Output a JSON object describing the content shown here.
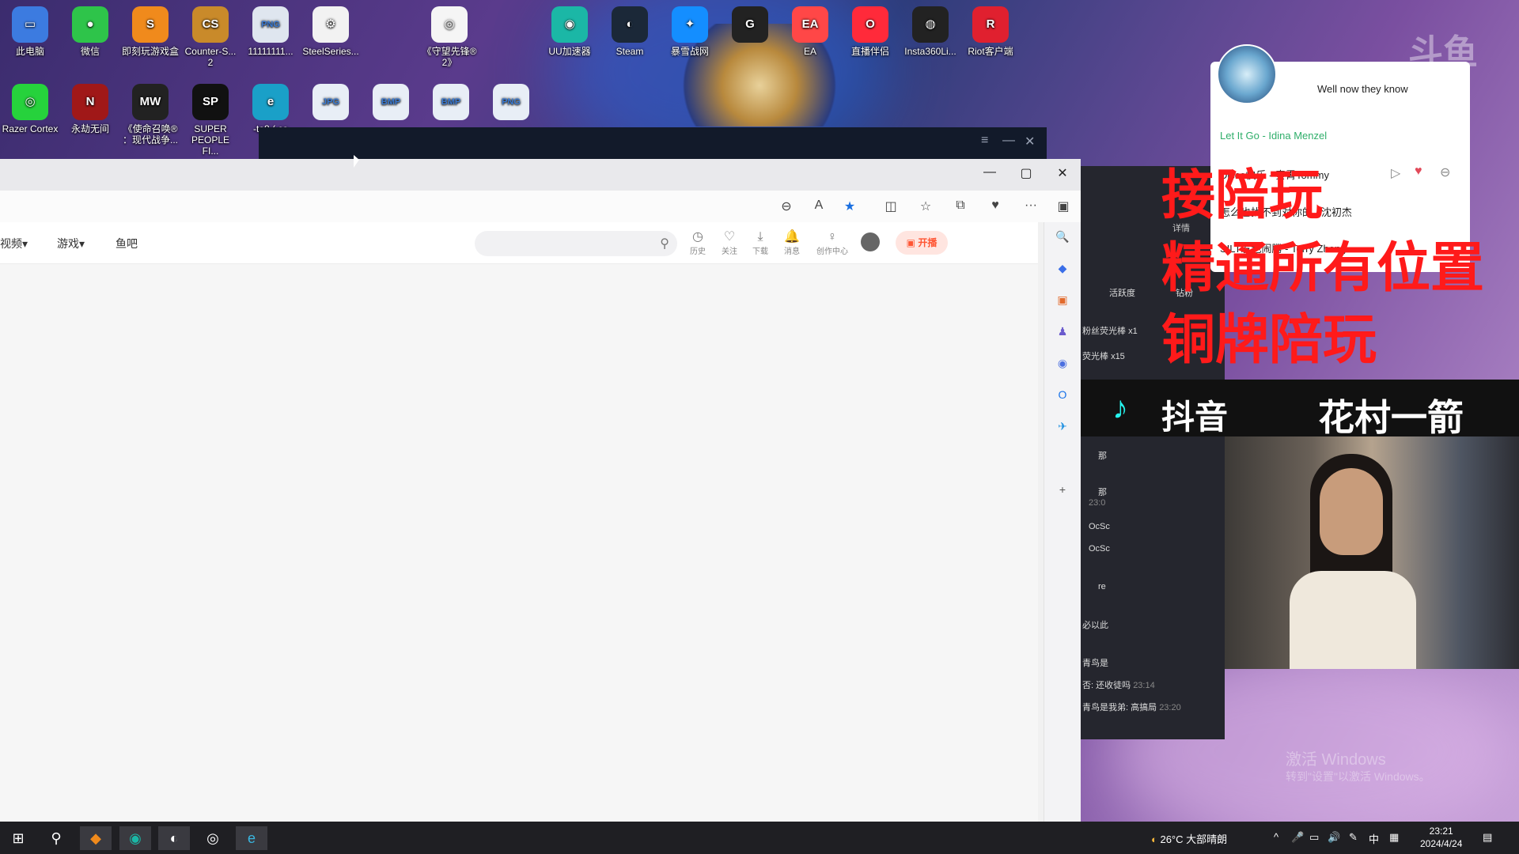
{
  "desktop": {
    "icons": [
      {
        "label": "此电脑",
        "glyph": "▭",
        "color": "#3c7be0"
      },
      {
        "label": "微信",
        "glyph": "●",
        "color": "#2ec44a"
      },
      {
        "label": "即刻玩游戏盒",
        "glyph": "S",
        "color": "#f08a1c"
      },
      {
        "label": "Counter-S... 2",
        "glyph": "CS",
        "color": "#c98a2a"
      },
      {
        "label": "11111111...",
        "glyph": "PNG",
        "color": "#dfe6ef"
      },
      {
        "label": "SteelSeries...",
        "glyph": "⚙",
        "color": "#f2f2f2"
      },
      {
        "label": "《守望先锋® 2》",
        "glyph": "◎",
        "color": "#f5f5f5"
      },
      {
        "label": "UU加速器",
        "glyph": "◉",
        "color": "#1bb7a6"
      },
      {
        "label": "Steam",
        "glyph": "◐",
        "color": "#1b2838"
      },
      {
        "label": "暴雪战网",
        "glyph": "✦",
        "color": "#148eff"
      },
      {
        "label": "",
        "glyph": "G",
        "color": "#222"
      },
      {
        "label": "EA",
        "glyph": "EA",
        "color": "#ff4747"
      },
      {
        "label": "直播伴侣",
        "glyph": "O",
        "color": "#ff2a3a"
      },
      {
        "label": "Insta360Li...",
        "glyph": "◍",
        "color": "#222"
      },
      {
        "label": "Riot客户端",
        "glyph": "R",
        "color": "#e0202f"
      },
      {
        "label": "Razer Cortex",
        "glyph": "◎",
        "color": "#26d23c"
      },
      {
        "label": "永劫无间",
        "glyph": "N",
        "color": "#a01818"
      },
      {
        "label": "《使命召唤® ：现代战争...",
        "glyph": "MW",
        "color": "#222"
      },
      {
        "label": "SUPER PEOPLE FI...",
        "glyph": "SP",
        "color": "#111"
      },
      {
        "label": "-ta8 ( co",
        "glyph": "e",
        "color": "#1aa0c8"
      },
      {
        "label": "",
        "glyph": "JPG",
        "color": "#e8eef6"
      },
      {
        "label": "",
        "glyph": "BMP",
        "color": "#e8eef6"
      },
      {
        "label": "",
        "glyph": "BMP",
        "color": "#e8eef6"
      },
      {
        "label": "",
        "glyph": "PNG",
        "color": "#e8eef6"
      }
    ]
  },
  "launcher": {
    "controls": [
      "≡",
      "—",
      "✕"
    ]
  },
  "browser": {
    "window_controls": {
      "minimize": "—",
      "maximize": "▢",
      "close": "✕"
    },
    "toolbar_icons": [
      "zoom-out",
      "read-aloud",
      "favorite-star",
      "split-screen",
      "favorites",
      "collections",
      "performance",
      "more",
      "sidebar"
    ],
    "toolbar_glyphs": [
      "⊖",
      "A",
      "★",
      "◫",
      "☆",
      "⧉",
      "♥",
      "···",
      "▣"
    ],
    "nav": {
      "video": "视频",
      "games": "游戏",
      "fishbar": "鱼吧",
      "search_placeholder": "",
      "icons": [
        {
          "label": "历史",
          "glyph": "◷"
        },
        {
          "label": "关注",
          "glyph": "♡"
        },
        {
          "label": "下载",
          "glyph": "⤓"
        },
        {
          "label": "消息",
          "glyph": "🔔"
        },
        {
          "label": "创作中心",
          "glyph": "♀"
        }
      ],
      "live_button": "开播"
    },
    "sidebar_glyphs": [
      "🔍",
      "◆",
      "▣",
      "♟",
      "◉",
      "O",
      "✈",
      "+"
    ],
    "sidebar_colors": [
      "#555555",
      "#3a6ee8",
      "#e26a2c",
      "#6a5acd",
      "#4b6fe0",
      "#1a73e8",
      "#1d8fe0",
      "#555555"
    ]
  },
  "stream_overlay": {
    "music": {
      "now_playing": "Well now they know",
      "song_1": "Let It Go - Idina Menzel",
      "song_2": "Disco快乐 - 秦霄Tommy",
      "song_3": "怎么也找不到对你的...沈初杰",
      "song_4": "SILT发色闹腾 - Terry Zhong..."
    },
    "promo_lines": [
      "接陪玩",
      "精通所有位置",
      "铜牌陪玩"
    ],
    "douyin_label": "抖音",
    "streamer_name": "花村一箭",
    "chat": {
      "details": "详情",
      "tab_active": "活跃度",
      "tab_other": "钻粉",
      "gift_1": "粉丝荧光棒",
      "gift_1_count": "x1",
      "gift_2": "荧光棒",
      "gift_2_count": "x15",
      "line_a": "那",
      "line_b": "那",
      "line_b_time": "23:0",
      "line_c": "OcSc",
      "line_d": "OcSc",
      "line_e": "re",
      "line_f": "必以此",
      "line_g": "青鸟是",
      "line_h": "否: 还收徒吗",
      "line_h_time": "23:14",
      "line_i": "青鸟是我弟: 高搞局",
      "line_i_time": "23:20"
    },
    "watermark_1": "激活 Windows",
    "watermark_2": "转到\"设置\"以激活 Windows。",
    "brand_watermark": "斗鱼"
  },
  "taskbar": {
    "apps": [
      "⊞",
      "⚲",
      "◆",
      "◉",
      "◐",
      "◎",
      "e"
    ],
    "weather": "26°C 大部晴朗",
    "tray_icons": [
      "^",
      "🎤",
      "▭",
      "🔊",
      "✎",
      "中",
      "▦"
    ],
    "time": "23:21",
    "date": "2024/4/24",
    "notification": "▤"
  },
  "colors": {
    "accent_red": "#ff1a1a",
    "douyu_orange": "#ff5533",
    "edge_blue": "#1a6fe0"
  }
}
